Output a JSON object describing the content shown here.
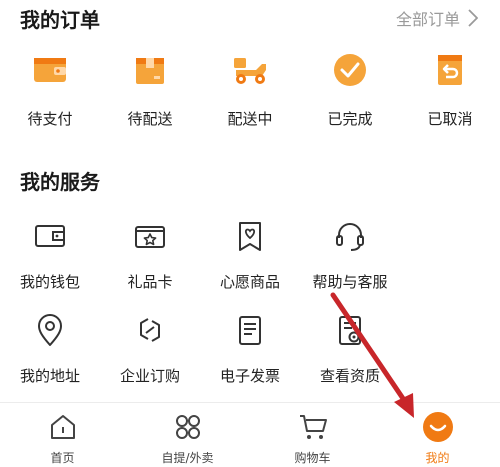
{
  "orders": {
    "title": "我的订单",
    "all_label": "全部订单",
    "items": [
      {
        "label": "待支付",
        "icon": "wallet-icon"
      },
      {
        "label": "待配送",
        "icon": "package-box-icon"
      },
      {
        "label": "配送中",
        "icon": "delivery-scooter-icon"
      },
      {
        "label": "已完成",
        "icon": "check-circle-icon"
      },
      {
        "label": "已取消",
        "icon": "cancel-return-icon"
      }
    ]
  },
  "services": {
    "title": "我的服务",
    "items": [
      {
        "label": "我的钱包",
        "icon": "wallet-icon"
      },
      {
        "label": "礼品卡",
        "icon": "gift-card-icon"
      },
      {
        "label": "心愿商品",
        "icon": "wishlist-heart-icon"
      },
      {
        "label": "帮助与客服",
        "icon": "headset-icon"
      },
      {
        "label": "我的地址",
        "icon": "location-pin-icon"
      },
      {
        "label": "企业订购",
        "icon": "enterprise-link-icon"
      },
      {
        "label": "电子发票",
        "icon": "invoice-icon"
      },
      {
        "label": "查看资质",
        "icon": "certificate-icon"
      }
    ]
  },
  "tabbar": {
    "items": [
      {
        "label": "首页",
        "icon": "home-icon"
      },
      {
        "label": "自提/外卖",
        "icon": "grid-icon"
      },
      {
        "label": "购物车",
        "icon": "cart-icon"
      },
      {
        "label": "我的",
        "icon": "profile-smile-icon",
        "active": true
      }
    ]
  },
  "colors": {
    "accent": "#f5a43a",
    "accent_dark": "#f07a13",
    "annotation_arrow": "#c8262a"
  }
}
